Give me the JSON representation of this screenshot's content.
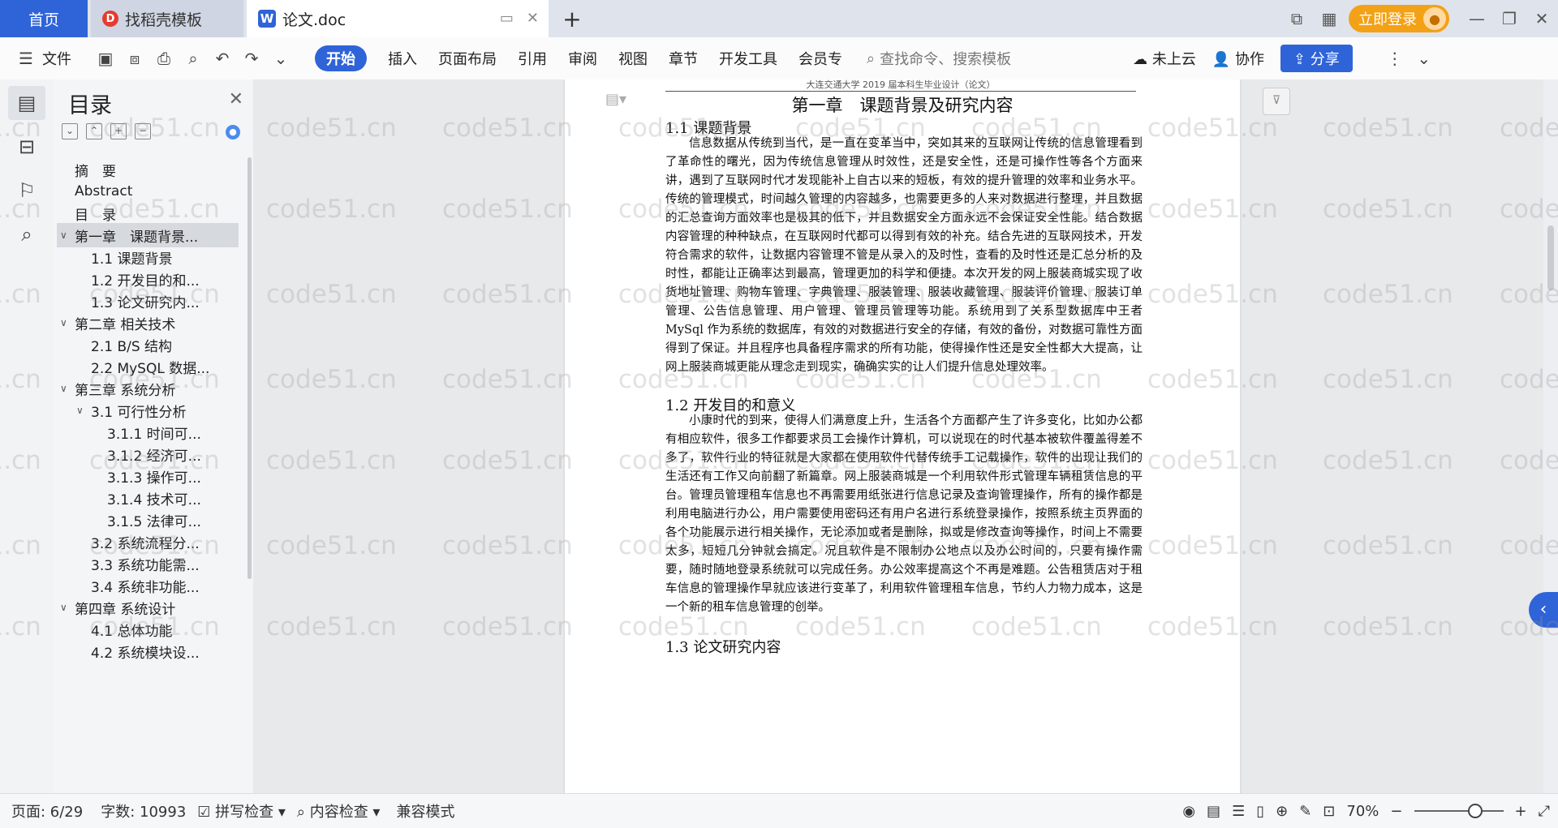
{
  "tabs": {
    "home": "首页",
    "daoke": "找稻壳模板",
    "doc": "论文.doc",
    "add": "+"
  },
  "window": {
    "login": "立即登录"
  },
  "menu": {
    "file": "文件",
    "items": [
      "开始",
      "插入",
      "页面布局",
      "引用",
      "审阅",
      "视图",
      "章节",
      "开发工具",
      "会员专"
    ],
    "search_placeholder": "查找命令、搜索模板",
    "cloud": "未上云",
    "collab": "协作",
    "share": "分享"
  },
  "toc": {
    "title": "目录",
    "items": [
      {
        "label": "摘　要",
        "level": 1
      },
      {
        "label": "Abstract",
        "level": 1
      },
      {
        "label": "目　录",
        "level": 1
      },
      {
        "label": "第一章　课题背景...",
        "level": 1,
        "expanded": true,
        "selected": true
      },
      {
        "label": "1.1 课题背景",
        "level": 2
      },
      {
        "label": "1.2 开发目的和...",
        "level": 2
      },
      {
        "label": "1.3 论文研究内...",
        "level": 2
      },
      {
        "label": "第二章 相关技术",
        "level": 1,
        "expanded": true
      },
      {
        "label": "2.1 B/S 结构",
        "level": 2
      },
      {
        "label": "2.2 MySQL 数据...",
        "level": 2
      },
      {
        "label": "第三章 系统分析",
        "level": 1,
        "expanded": true
      },
      {
        "label": "3.1 可行性分析",
        "level": 2,
        "expanded": true
      },
      {
        "label": "3.1.1 时间可...",
        "level": 3
      },
      {
        "label": "3.1.2 经济可...",
        "level": 3
      },
      {
        "label": "3.1.3 操作可...",
        "level": 3
      },
      {
        "label": "3.1.4 技术可...",
        "level": 3
      },
      {
        "label": "3.1.5 法律可...",
        "level": 3
      },
      {
        "label": "3.2 系统流程分...",
        "level": 2
      },
      {
        "label": "3.3 系统功能需...",
        "level": 2
      },
      {
        "label": "3.4 系统非功能...",
        "level": 2
      },
      {
        "label": "第四章 系统设计",
        "level": 1,
        "expanded": true
      },
      {
        "label": "4.1 总体功能",
        "level": 2
      },
      {
        "label": "4.2 系统模块设...",
        "level": 2
      }
    ]
  },
  "document": {
    "running_header": "大连交通大学 2019 届本科生毕业设计（论文）",
    "chapter_title": "第一章　课题背景及研究内容",
    "sections": [
      {
        "heading": "1.1  课题背景",
        "body": "信息数据从传统到当代，是一直在变革当中，突如其来的互联网让传统的信息管理看到了革命性的曙光，因为传统信息管理从时效性，还是安全性，还是可操作性等各个方面来讲，遇到了互联网时代才发现能补上自古以来的短板，有效的提升管理的效率和业务水平。传统的管理模式，时间越久管理的内容越多，也需要更多的人来对数据进行整理，并且数据的汇总查询方面效率也是极其的低下，并且数据安全方面永远不会保证安全性能。结合数据内容管理的种种缺点，在互联网时代都可以得到有效的补充。结合先进的互联网技术，开发符合需求的软件，让数据内容管理不管是从录入的及时性，查看的及时性还是汇总分析的及时性，都能让正确率达到最高，管理更加的科学和便捷。本次开发的网上服装商城实现了收货地址管理、购物车管理、字典管理、服装管理、服装收藏管理、服装评价管理、服装订单管理、公告信息管理、用户管理、管理员管理等功能。系统用到了关系型数据库中王者 MySql 作为系统的数据库，有效的对数据进行安全的存储，有效的备份，对数据可靠性方面得到了保证。并且程序也具备程序需求的所有功能，使得操作性还是安全性都大大提高，让网上服装商城更能从理念走到现实，确确实实的让人们提升信息处理效率。"
      },
      {
        "heading": "1.2  开发目的和意义",
        "body": "小康时代的到来，使得人们满意度上升，生活各个方面都产生了许多变化，比如办公都有相应软件，很多工作都要求员工会操作计算机，可以说现在的时代基本被软件覆盖得差不多了，软件行业的特征就是大家都在使用软件代替传统手工记载操作，软件的出现让我们的生活还有工作又向前翻了新篇章。网上服装商城是一个利用软件形式管理车辆租赁信息的平台。管理员管理租车信息也不再需要用纸张进行信息记录及查询管理操作，所有的操作都是利用电脑进行办公，用户需要使用密码还有用户名进行系统登录操作，按照系统主页界面的各个功能展示进行相关操作，无论添加或者是删除，拟或是修改查询等操作，时间上不需要太多，短短几分钟就会搞定。况且软件是不限制办公地点以及办公时间的，只要有操作需要，随时随地登录系统就可以完成任务。办公效率提高这个不再是难题。公告租赁店对于租车信息的管理操作早就应该进行变革了，利用软件管理租车信息，节约人力物力成本，这是一个新的租车信息管理的创举。"
      },
      {
        "heading": "1.3  论文研究内容",
        "body": ""
      }
    ]
  },
  "watermark": "code51.cn",
  "status": {
    "page": "页面: 6/29",
    "words": "字数: 10993",
    "spell": "拼写检查",
    "content": "内容检查",
    "compat": "兼容模式",
    "zoom": "70%"
  },
  "colors": {
    "accent": "#2f63d8",
    "login": "#f3a116"
  }
}
